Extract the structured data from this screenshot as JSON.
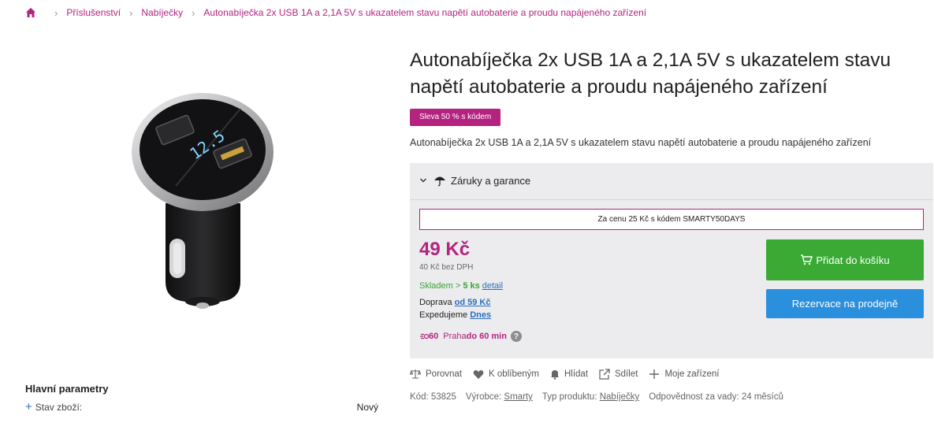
{
  "breadcrumb": {
    "items": [
      "Příslušenství",
      "Nabíječky",
      "Autonabíječka 2x USB 1A a 2,1A 5V s ukazatelem stavu napětí autobaterie a proudu napájeného zařízení"
    ]
  },
  "product": {
    "title": "Autonabíječka 2x USB 1A a 2,1A 5V s ukazatelem stavu napětí autobaterie a proudu napájeného zařízení",
    "badge": "Sleva 50 % s kódem",
    "description": "Autonabíječka 2x USB 1A a 2,1A 5V s ukazatelem stavu napětí autobaterie a proudu napájeného zařízení",
    "image_display_text": "12.5"
  },
  "purchase": {
    "warranty_label": "Záruky a garance",
    "promo_text": "Za cenu 25 Kč s kódem SMARTY50DAYS",
    "price": "49 Kč",
    "price_net": "40 Kč bez DPH",
    "stock_prefix": "Skladem > ",
    "stock_count": "5 ks",
    "stock_link": "detail",
    "shipping_label": "Doprava ",
    "shipping_link": "od 59 Kč",
    "dispatch_label": "Expedujeme ",
    "dispatch_link": "Dnes",
    "express_badge": "60",
    "express_city": "Praha ",
    "express_time": "do 60 min",
    "express_help": "?",
    "add_to_cart": "Přidat do košíku",
    "reserve": "Rezervace na prodejně"
  },
  "actions": [
    "Porovnat",
    "K oblíbeným",
    "Hlídat",
    "Sdílet",
    "Moje zařízení"
  ],
  "meta": {
    "code_label": "Kód: ",
    "code": "53825",
    "maker_label": "Výrobce: ",
    "maker": "Smarty",
    "type_label": "Typ produktu: ",
    "type": "Nabíječky",
    "liability": "Odpovědnost za vady: 24 měsíců"
  },
  "params": {
    "title": "Hlavní parametry",
    "row_label": "Stav zboží:",
    "row_value": "Nový"
  },
  "colors": {
    "brand": "#b3237f",
    "cart_green": "#3aaa35",
    "reserve_blue": "#2a8fdc",
    "stock_green": "#3aa335",
    "link_blue": "#2a6fc0"
  }
}
